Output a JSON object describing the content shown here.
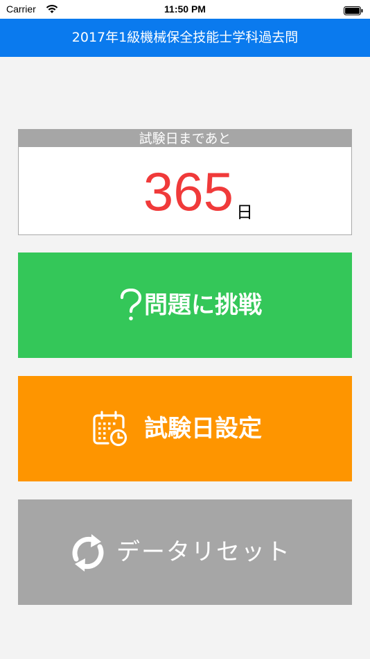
{
  "status_bar": {
    "carrier": "Carrier",
    "time": "11:50 PM"
  },
  "nav": {
    "title": "2017年1級機械保全技能士学科過去問"
  },
  "countdown": {
    "header": "試験日まであと",
    "days": "365",
    "unit": "日",
    "number_color": "#f03a3a"
  },
  "buttons": {
    "challenge": {
      "label": "問題に挑戦",
      "icon": "question-mark-icon",
      "color": "#34c759"
    },
    "setting": {
      "label": "試験日設定",
      "icon": "calendar-clock-icon",
      "color": "#fe9500"
    },
    "reset": {
      "label": "データリセット",
      "icon": "refresh-icon",
      "color": "#a6a6a6"
    }
  },
  "colors": {
    "nav_bar": "#0a7aee",
    "background": "#f3f3f3"
  }
}
